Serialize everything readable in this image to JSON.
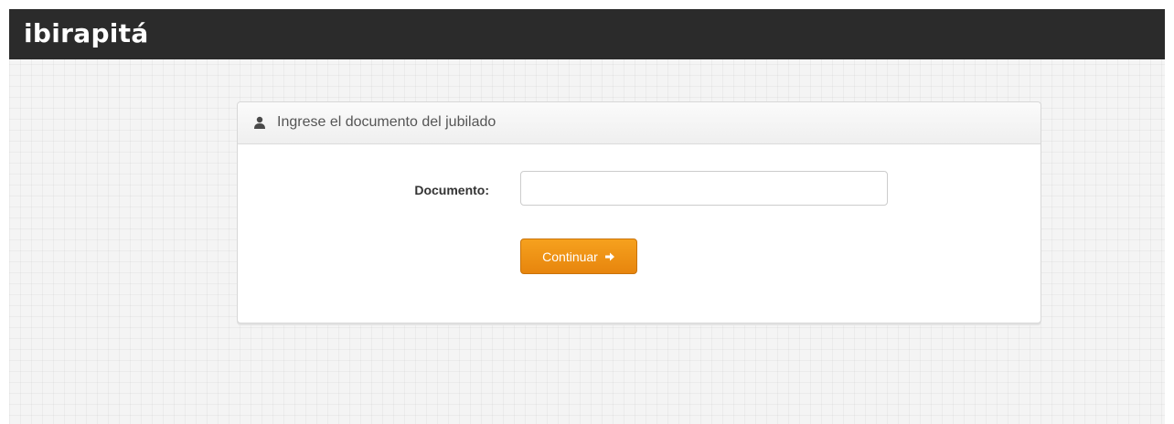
{
  "app": {
    "brand": "ibirapitá"
  },
  "panel": {
    "title": "Ingrese el documento del jubilado",
    "header_icon": "user-icon"
  },
  "form": {
    "document_label": "Documento:",
    "document_value": "",
    "document_placeholder": "",
    "continue_label": "Continuar",
    "continue_icon": "arrow-right-icon"
  },
  "colors": {
    "topbar": "#2b2b2b",
    "accent": "#ef9214",
    "background": "#f4f4f4"
  }
}
